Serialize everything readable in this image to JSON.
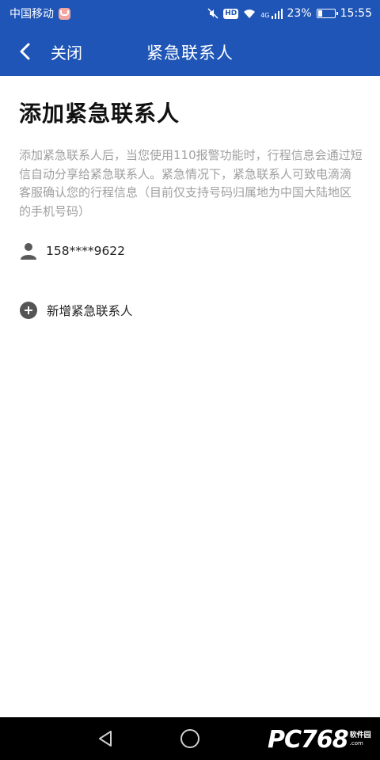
{
  "status_bar": {
    "carrier": "中国移动",
    "battery": "23%",
    "time": "15:55",
    "hd": "HD",
    "network": "4G",
    "icons": [
      "carrier-badge-icon",
      "mute-icon",
      "hd-icon",
      "wifi-icon",
      "signal-icon",
      "battery-icon"
    ]
  },
  "nav": {
    "close_label": "关闭",
    "title": "紧急联系人",
    "back_icon": "chevron-left-icon"
  },
  "content": {
    "title": "添加紧急联系人",
    "description": "添加紧急联系人后，当您使用110报警功能时，行程信息会通过短信自动分享给紧急联系人。紧急情况下，紧急联系人可致电滴滴客服确认您的行程信息（目前仅支持号码归属地为中国大陆地区的手机号码）"
  },
  "contacts": [
    {
      "phone": "158****9622",
      "icon": "person-icon"
    }
  ],
  "add_contact": {
    "label": "新增紧急联系人",
    "icon": "plus-circle-icon"
  },
  "watermark": {
    "text": "PC768",
    "small_top": "软件园",
    "small_bottom": ".com"
  },
  "colors": {
    "brand": "#1f55b7",
    "description_text": "#a0a0a0",
    "title_text": "#111111"
  }
}
